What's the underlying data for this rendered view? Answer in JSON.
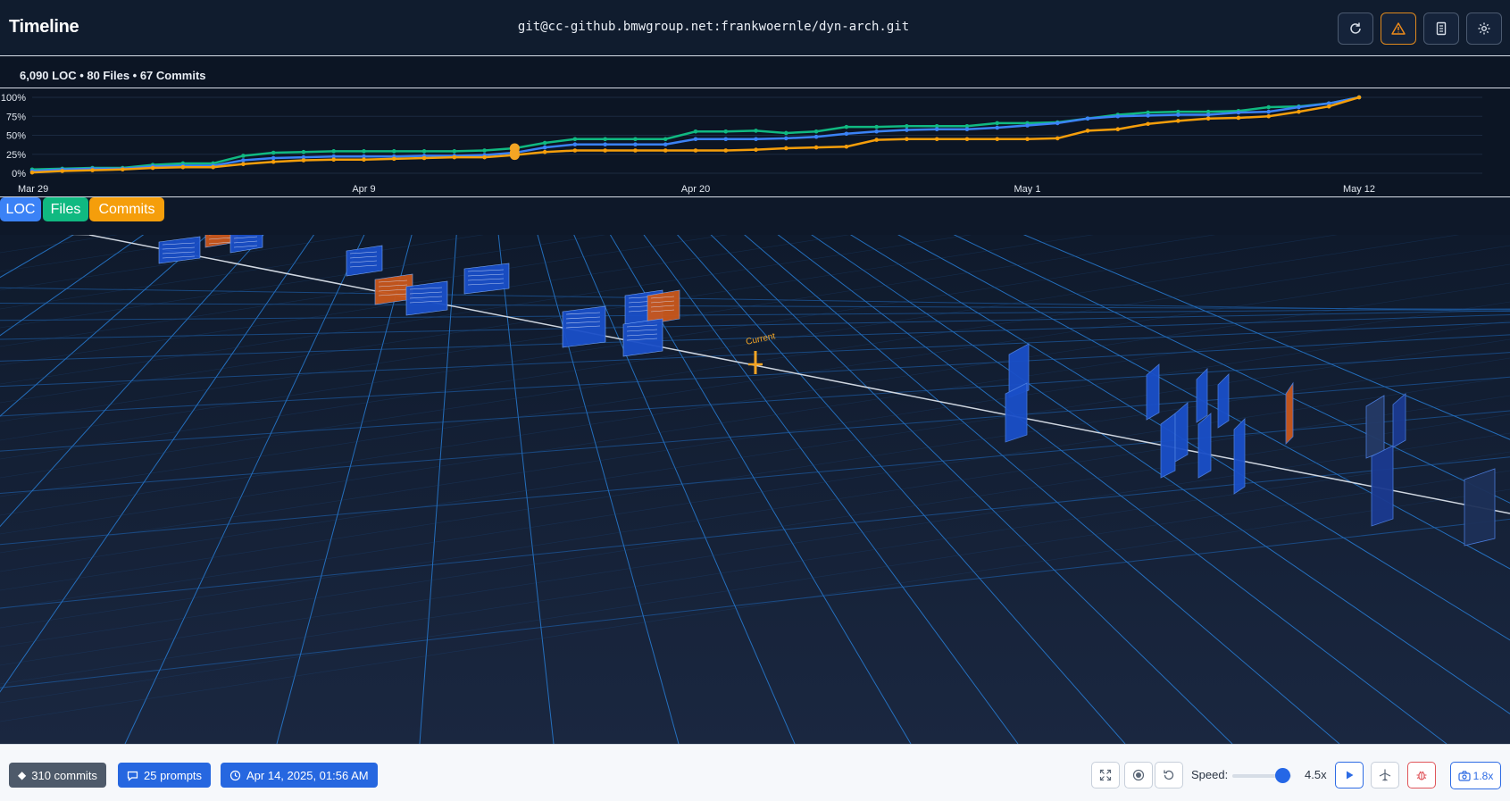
{
  "header": {
    "title": "Timeline",
    "repo": "git@cc-github.bmwgroup.net:frankwoernle/dyn-arch.git",
    "buttons": [
      {
        "name": "refresh-button",
        "icon": "refresh-icon"
      },
      {
        "name": "warning-button",
        "icon": "warning-triangle-icon"
      },
      {
        "name": "document-button",
        "icon": "document-icon"
      },
      {
        "name": "settings-button",
        "icon": "gear-icon"
      }
    ]
  },
  "stats": {
    "text": "6,090 LOC • 80 Files • 67 Commits"
  },
  "legend": {
    "loc": "LOC",
    "files": "Files",
    "commits": "Commits"
  },
  "colors": {
    "loc": "#3b82f6",
    "files": "#10b981",
    "commits": "#f59e0b"
  },
  "chart_data": {
    "type": "line",
    "x": [
      "Mar 29",
      "Mar 30",
      "Mar 31",
      "Apr 1",
      "Apr 2",
      "Apr 3",
      "Apr 4",
      "Apr 5",
      "Apr 6",
      "Apr 7",
      "Apr 8",
      "Apr 9",
      "Apr 10",
      "Apr 11",
      "Apr 12",
      "Apr 13",
      "Apr 14",
      "Apr 15",
      "Apr 16",
      "Apr 17",
      "Apr 18",
      "Apr 19",
      "Apr 20",
      "Apr 21",
      "Apr 22",
      "Apr 23",
      "Apr 24",
      "Apr 25",
      "Apr 26",
      "Apr 27",
      "Apr 28",
      "Apr 29",
      "Apr 30",
      "May 1",
      "May 2",
      "May 3",
      "May 4",
      "May 5",
      "May 6",
      "May 7",
      "May 8",
      "May 9",
      "May 10",
      "May 11",
      "May 12"
    ],
    "x_ticks": [
      "Mar 29",
      "Apr 9",
      "Apr 20",
      "May 1",
      "May 12"
    ],
    "y_ticks": [
      "0%",
      "25%",
      "50%",
      "75%",
      "100%"
    ],
    "ylim": [
      0,
      100
    ],
    "current_date": "Apr 14",
    "series": [
      {
        "name": "LOC",
        "values": [
          3,
          5,
          6,
          6,
          9,
          10,
          10,
          17,
          20,
          21,
          22,
          22,
          22,
          23,
          23,
          24,
          27,
          34,
          38,
          38,
          38,
          38,
          45,
          45,
          45,
          46,
          48,
          52,
          55,
          57,
          58,
          58,
          60,
          63,
          66,
          72,
          75,
          76,
          77,
          77,
          80,
          81,
          87,
          92,
          100
        ]
      },
      {
        "name": "Files",
        "values": [
          5,
          6,
          7,
          7,
          11,
          13,
          13,
          23,
          27,
          28,
          29,
          29,
          29,
          29,
          29,
          30,
          33,
          40,
          45,
          45,
          45,
          45,
          55,
          55,
          56,
          53,
          55,
          61,
          61,
          62,
          62,
          62,
          66,
          66,
          67,
          72,
          77,
          80,
          81,
          81,
          82,
          87,
          88,
          92,
          100
        ]
      },
      {
        "name": "Commits",
        "values": [
          1,
          3,
          4,
          5,
          7,
          8,
          8,
          12,
          15,
          17,
          18,
          18,
          19,
          20,
          21,
          21,
          24,
          28,
          30,
          30,
          30,
          30,
          30,
          30,
          31,
          33,
          34,
          35,
          44,
          45,
          45,
          45,
          45,
          45,
          46,
          56,
          58,
          65,
          69,
          72,
          73,
          75,
          81,
          88,
          100
        ]
      }
    ]
  },
  "scene": {
    "current_label": "Current"
  },
  "bottombar": {
    "commits": "310 commits",
    "prompts": "25 prompts",
    "date": "Apr 14, 2025, 01:56 AM",
    "speed_label": "Speed:",
    "speed_value": "4.5x",
    "speed_level": 0.85,
    "camera": "1.8x"
  }
}
